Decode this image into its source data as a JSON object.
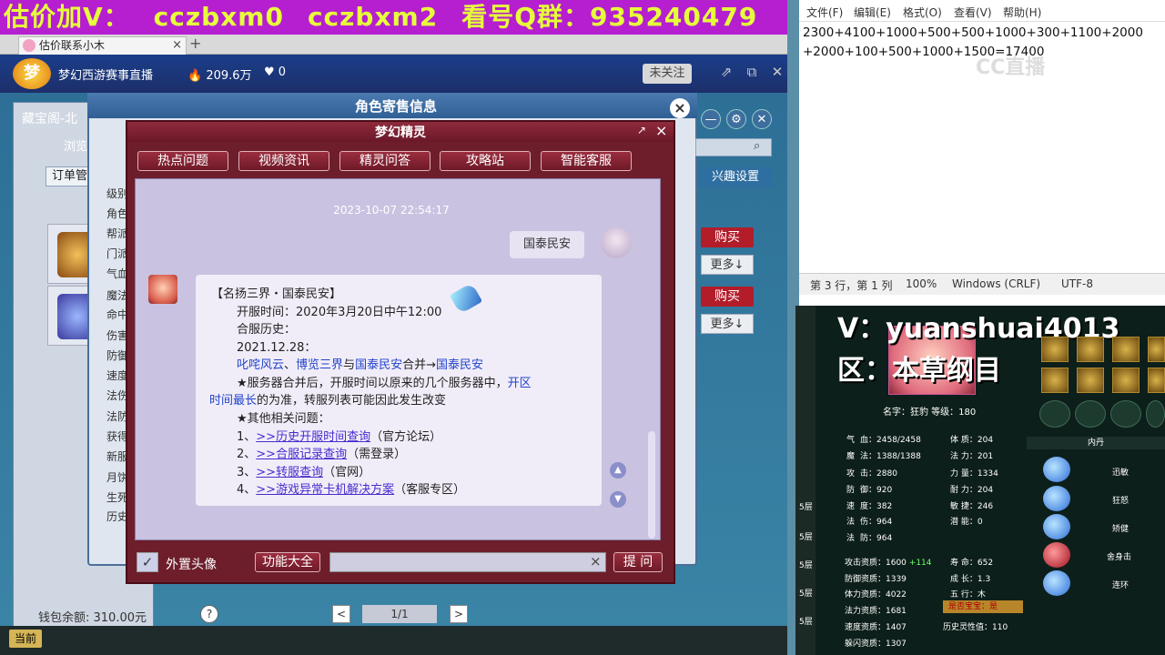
{
  "banner": {
    "segments": [
      "估价加V：",
      "cczbxm0",
      "cczbxm2",
      "看号Q群：935240479"
    ]
  },
  "browser": {
    "tab_title": "估价联系小木",
    "tab_close": "×",
    "new_tab": "+"
  },
  "stream": {
    "channel": "梦幻西游赛事直播",
    "heat": "209.6万",
    "likes": "0",
    "follow_label": "未关注"
  },
  "treasure": {
    "title": "藏宝阁-北",
    "browse": "浏览",
    "order_tab": "订单管理",
    "side_items": [
      "级别",
      "角色",
      "帮派",
      "门派",
      "气血",
      "魔法",
      "命中",
      "伤害",
      "防御",
      "速度",
      "法伤",
      "法防",
      "获得",
      "新服",
      "月饼",
      "生死",
      "历史"
    ],
    "interest_label": "兴趣设置",
    "buy_label": "购买",
    "more_label": "更多↓",
    "wallet": "钱包余额: 310.00元",
    "help": "?",
    "page": "1/1",
    "prev": "<",
    "next": ">",
    "current": "当前"
  },
  "sale_panel": {
    "title": "角色寄售信息",
    "close": "×"
  },
  "sprite": {
    "title": "梦幻精灵",
    "expand": "↗",
    "close": "×",
    "nav": [
      "热点问题",
      "视频资讯",
      "精灵问答",
      "攻略站",
      "智能客服"
    ],
    "timestamp": "2023-10-07 22:54:17",
    "user_message": "国泰民安",
    "reply": {
      "heading": "【名扬三界・国泰民安】",
      "open_label": "开服时间：",
      "open_value": "2020年3月20日中午12:00",
      "merge_label": "合服历史：",
      "merge_date": "2021.12.28：",
      "merge_a": "叱咤风云",
      "merge_sep1": "、",
      "merge_b": "博览三界",
      "merge_sep2": "与",
      "merge_c": "国泰民安",
      "merge_sep3": "合并→",
      "merge_d": "国泰民安",
      "note_1": "★服务器合并后，开服时间以原来的几个服务器中，",
      "note_hl_1": "开区",
      "note_hl_2": "时间最长",
      "note_2": "的为准，转服列表可能因此发生改变",
      "other": "★其他相关问题：",
      "links": [
        {
          "num": "1、",
          "text": ">>历史开服时间查询",
          "note": "（官方论坛）"
        },
        {
          "num": "2、",
          "text": ">>合服记录查询",
          "note": "（需登录）"
        },
        {
          "num": "3、",
          "text": ">>转服查询",
          "note": "（官网）"
        },
        {
          "num": "4、",
          "text": ">>游戏异常卡机解决方案",
          "note": "（客服专区）"
        }
      ]
    },
    "outer_avatar_label": "外置头像",
    "check_mark": "✓",
    "func_label": "功能大全",
    "ask_placeholder": "",
    "ask_clear": "×",
    "ask_label": "提 问"
  },
  "notepad": {
    "menu": [
      "文件(F)",
      "编辑(E)",
      "格式(O)",
      "查看(V)",
      "帮助(H)"
    ],
    "content": "2300+4100+1000+500+500+1000+300+1100+2000+2000+100+500+1000+1500=17400",
    "status": [
      "第 3 行，第 1 列",
      "100%",
      "Windows (CRLF)",
      "UTF-8"
    ],
    "watermark": "CC直播"
  },
  "character": {
    "v_label": "V：yuanshuai4013",
    "zone_label": "区：本草纲目",
    "name_line": "名字：狂豹  等级：180",
    "neidan": "内丹",
    "skills": [
      "迅敏",
      "狂怒",
      "矫健",
      "舍身击",
      "连环"
    ],
    "stats": [
      [
        "气",
        "血：2458/2458"
      ],
      [
        "魔",
        "法：1388/1388"
      ],
      [
        "攻",
        "击：2880"
      ],
      [
        "防",
        "御：920"
      ],
      [
        "速",
        "度：382"
      ],
      [
        "法",
        "伤：964"
      ],
      [
        "法",
        "防：964"
      ]
    ],
    "attrs": [
      [
        "体",
        "质：204"
      ],
      [
        "法",
        "力：201"
      ],
      [
        "力",
        "量：1334"
      ],
      [
        "耐",
        "力：204"
      ],
      [
        "敏",
        "捷：246"
      ],
      [
        "潜",
        "能：0"
      ]
    ],
    "qual": [
      [
        "攻击资质：1600",
        "+114"
      ],
      [
        "防御资质：1339",
        ""
      ],
      [
        "体力资质：4022",
        ""
      ],
      [
        "法力资质：1681",
        ""
      ],
      [
        "速度资质：1407",
        ""
      ],
      [
        "躲闪资质：1307",
        ""
      ]
    ],
    "misc": [
      "寿    命：652",
      "成    长：1.3",
      "五    行：木"
    ],
    "baobao": "是否宝宝：是",
    "history": "历史灵性值：110",
    "levels": [
      "5层",
      "5层",
      "5层",
      "5层",
      "5层"
    ]
  }
}
